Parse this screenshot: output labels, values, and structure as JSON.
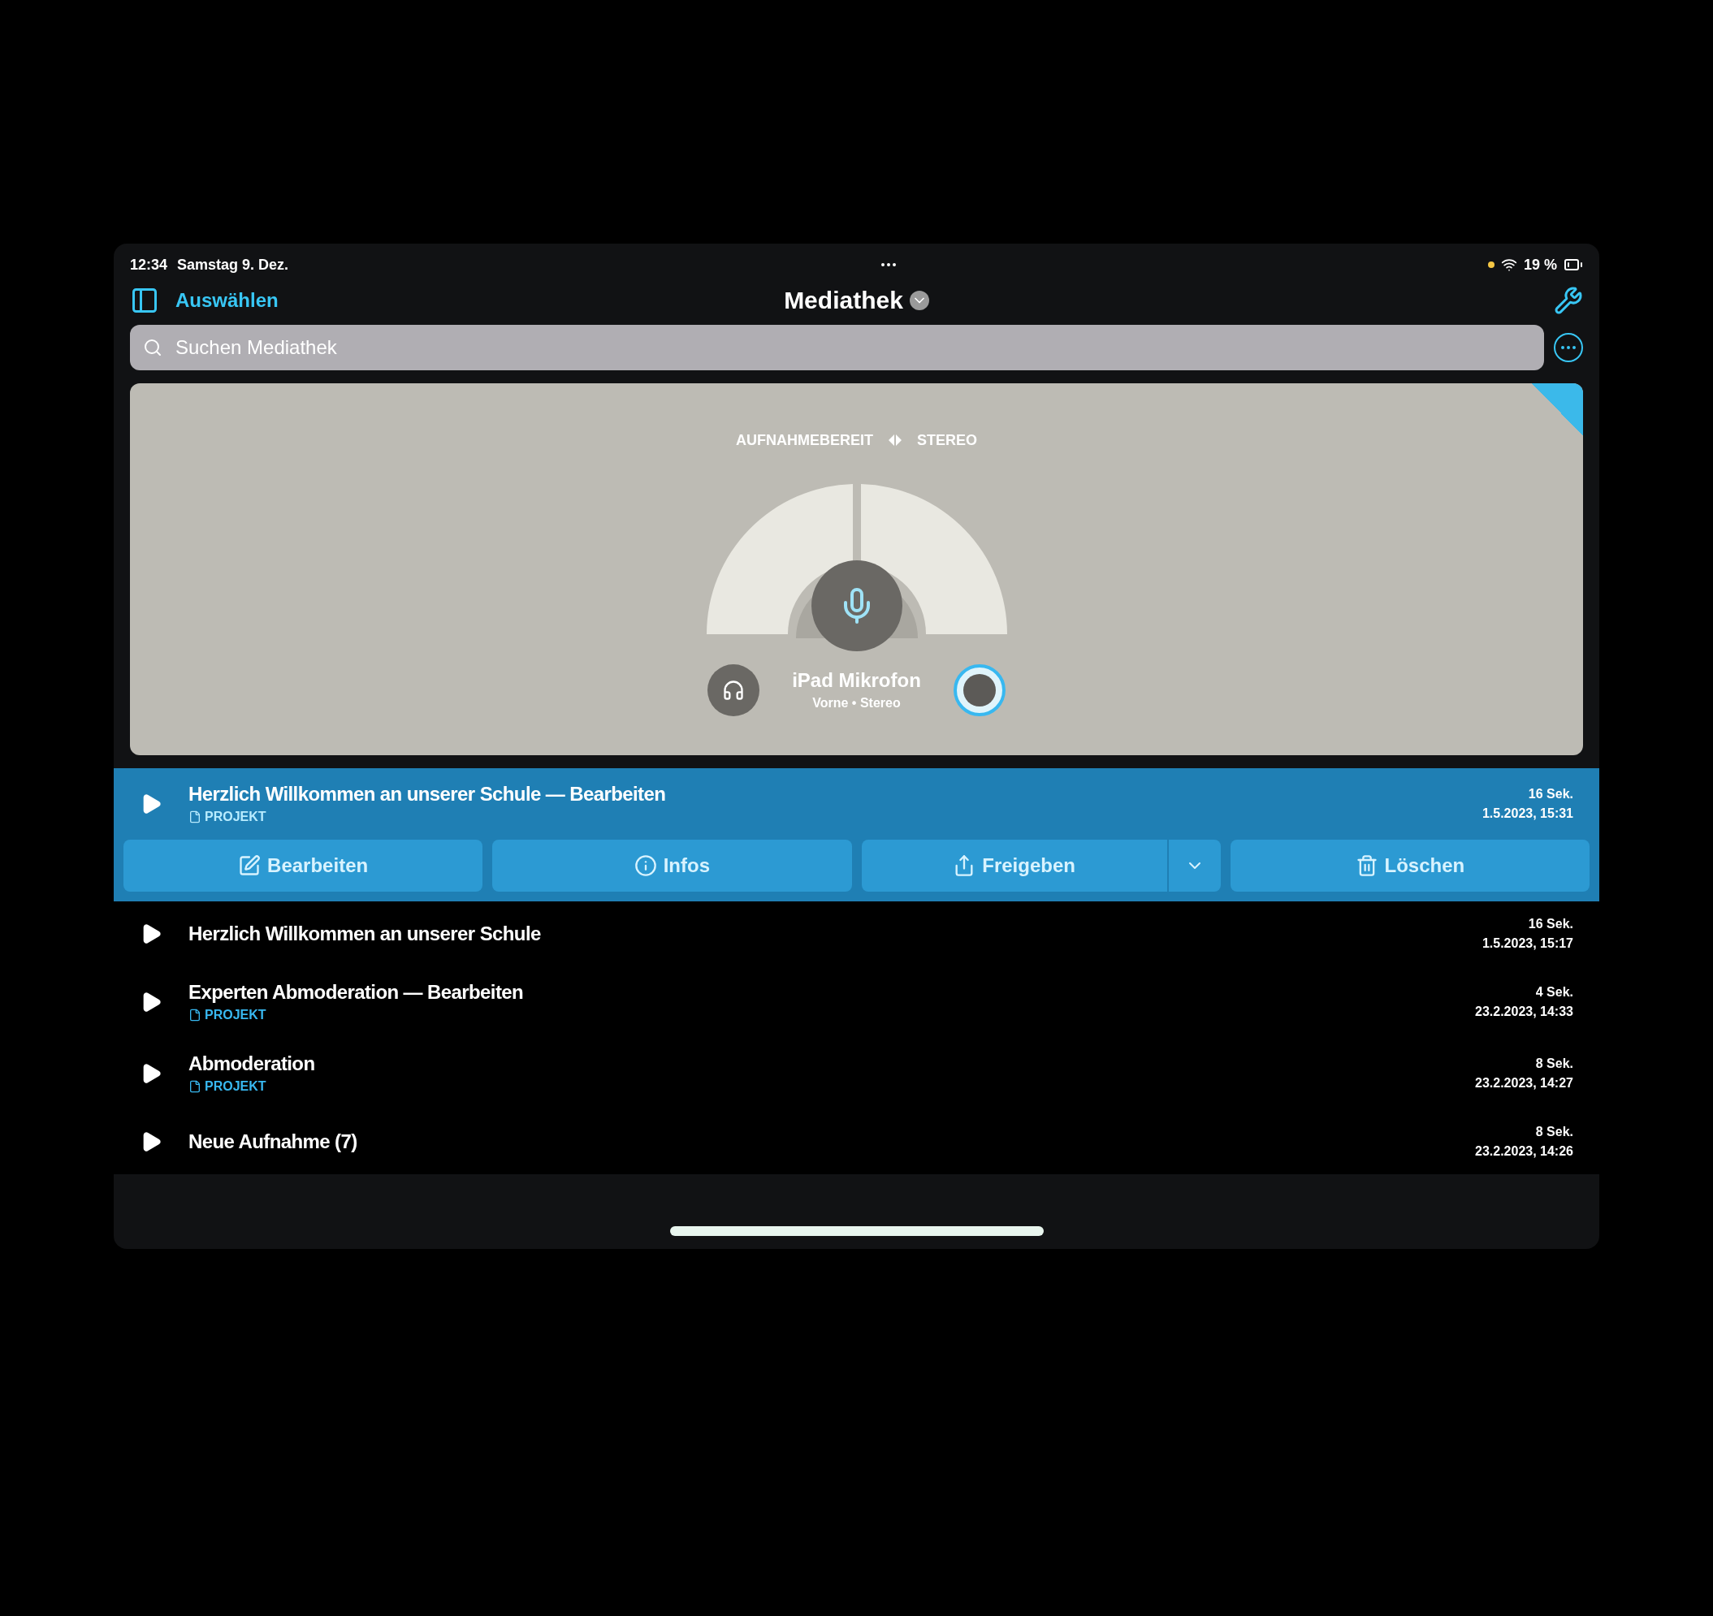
{
  "status_bar": {
    "time": "12:34",
    "date": "Samstag 9. Dez.",
    "battery": "19 %"
  },
  "nav": {
    "select_label": "Auswählen",
    "title": "Mediathek"
  },
  "search": {
    "placeholder": "Suchen Mediathek"
  },
  "recorder": {
    "status": "AUFNAHMEBEREIT",
    "mode": "STEREO",
    "device": "iPad Mikrofon",
    "device_detail": "Vorne • Stereo"
  },
  "recordings": [
    {
      "title": "Herzlich Willkommen an unserer Schule — Bearbeiten",
      "tag": "PROJEKT",
      "duration": "16 Sek.",
      "date": "1.5.2023, 15:31",
      "selected": true
    },
    {
      "title": "Herzlich Willkommen an unserer Schule",
      "duration": "16 Sek.",
      "date": "1.5.2023, 15:17",
      "selected": false
    },
    {
      "title": "Experten Abmoderation — Bearbeiten",
      "tag": "PROJEKT",
      "duration": "4 Sek.",
      "date": "23.2.2023, 14:33",
      "selected": false
    },
    {
      "title": "Abmoderation",
      "tag": "PROJEKT",
      "duration": "8 Sek.",
      "date": "23.2.2023, 14:27",
      "selected": false
    },
    {
      "title": "Neue Aufnahme (7)",
      "duration": "8 Sek.",
      "date": "23.2.2023, 14:26",
      "selected": false
    }
  ],
  "actions": [
    {
      "kind": "edit",
      "label": "Bearbeiten"
    },
    {
      "kind": "info",
      "label": "Infos"
    },
    {
      "kind": "share",
      "label": "Freigeben"
    },
    {
      "kind": "delete",
      "label": "Löschen"
    }
  ]
}
